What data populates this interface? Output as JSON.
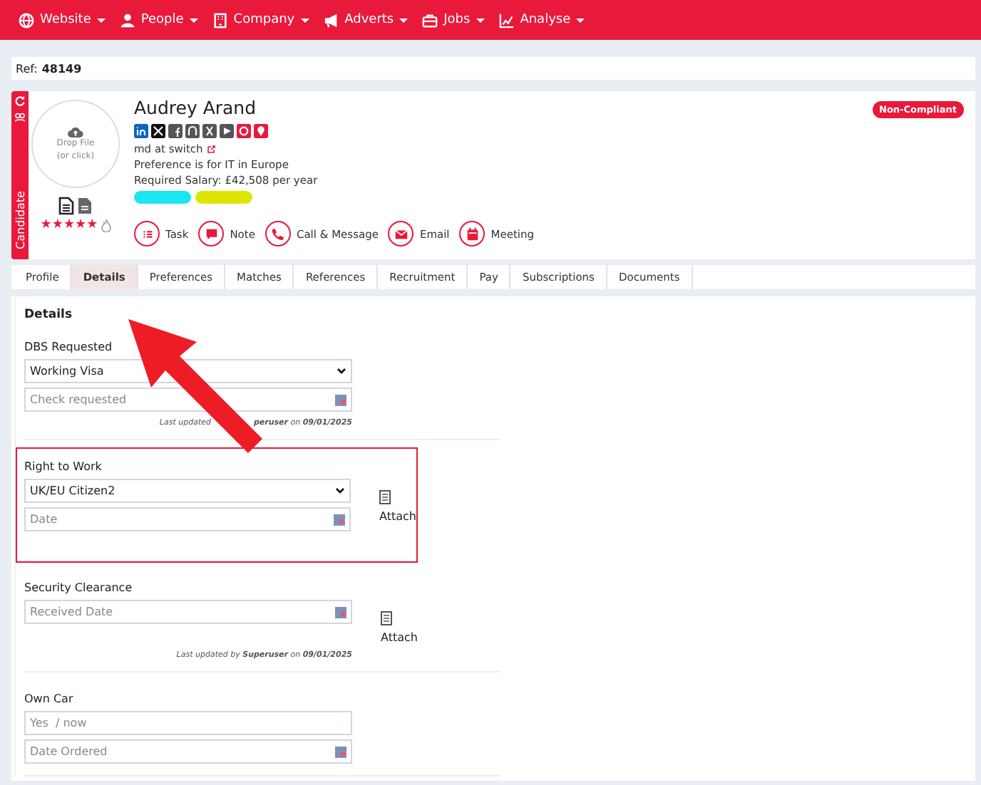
{
  "nav": [
    {
      "label": "Website"
    },
    {
      "label": "People"
    },
    {
      "label": "Company"
    },
    {
      "label": "Adverts"
    },
    {
      "label": "Jobs"
    },
    {
      "label": "Analyse"
    }
  ],
  "ref": {
    "label": "Ref:",
    "value": "48149"
  },
  "candidate": {
    "side_label": "Candidate",
    "drop_label": "Drop File",
    "drop_hint": "(or click)",
    "name": "Audrey Arand",
    "status": "Non-Compliant",
    "stars": 5,
    "job": "md at switch",
    "preference": "Preference is for IT in Europe",
    "salary": "Required Salary: £42,508 per year",
    "tags": [
      {
        "color": "#19e6f0"
      },
      {
        "color": "#dde600"
      }
    ],
    "actions": [
      {
        "label": "Task"
      },
      {
        "label": "Note"
      },
      {
        "label": "Call & Message"
      },
      {
        "label": "Email"
      },
      {
        "label": "Meeting"
      }
    ]
  },
  "tabs": [
    {
      "label": "Profile",
      "selected": false
    },
    {
      "label": "Details",
      "selected": true
    },
    {
      "label": "Preferences",
      "selected": false
    },
    {
      "label": "Matches",
      "selected": false
    },
    {
      "label": "References",
      "selected": false
    },
    {
      "label": "Recruitment",
      "selected": false
    },
    {
      "label": "Pay",
      "selected": false
    },
    {
      "label": "Subscriptions",
      "selected": false
    },
    {
      "label": "Documents",
      "selected": false
    }
  ],
  "details": {
    "title": "Details",
    "sections": [
      {
        "label": "DBS Requested",
        "highlighted": false,
        "fields": [
          {
            "kind": "select",
            "value": "Working Visa"
          },
          {
            "kind": "date",
            "placeholder": "Check requested"
          }
        ],
        "note": [
          "Last updated",
          "**peruser** on **09/01/2025**"
        ]
      },
      {
        "label": "Right to Work",
        "highlighted": true,
        "fields": [
          {
            "kind": "select",
            "value": "UK/EU Citizen2"
          },
          {
            "kind": "date",
            "placeholder": "Date"
          }
        ],
        "attach": "Attach"
      },
      {
        "label": "Security Clearance",
        "highlighted": false,
        "fields": [
          {
            "kind": "date",
            "placeholder": "Received Date"
          }
        ],
        "attach": "Attach",
        "note": [
          "Last updated by **Superuser** on **09/01/2025**"
        ]
      },
      {
        "label": "Own Car",
        "highlighted": false,
        "fields": [
          {
            "kind": "text",
            "placeholder": "Yes  / now"
          },
          {
            "kind": "date",
            "placeholder": "Date Ordered"
          }
        ]
      }
    ]
  }
}
